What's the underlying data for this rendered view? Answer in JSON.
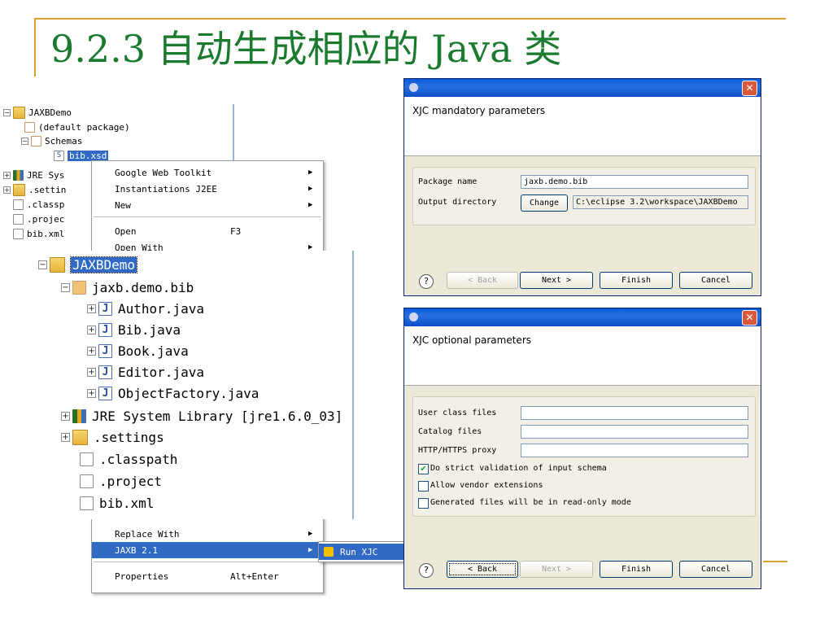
{
  "slide": {
    "title": "9.2.3  自动生成相应的 Java 类"
  },
  "small_tree": {
    "items": [
      {
        "label": "JAXBDemo",
        "toggle": "−"
      },
      {
        "label": "(default package)",
        "toggle": ""
      },
      {
        "label": "Schemas",
        "toggle": "−"
      },
      {
        "label": "bib.xsd",
        "toggle": "",
        "badge": "S"
      },
      {
        "label": "JRE Sys",
        "toggle": "+"
      },
      {
        "label": ".settin",
        "toggle": "+"
      },
      {
        "label": ".classp",
        "toggle": ""
      },
      {
        "label": ".projec",
        "toggle": ""
      },
      {
        "label": "bib.xml",
        "toggle": ""
      }
    ]
  },
  "context_menu": {
    "items": [
      {
        "label": "Google Web Toolkit",
        "accel": "",
        "submenu": true
      },
      {
        "label": "Instantiations J2EE",
        "accel": "",
        "submenu": true
      },
      {
        "label": "New",
        "accel": "",
        "submenu": true
      },
      {
        "label": "Open",
        "accel": "F3",
        "submenu": false
      },
      {
        "label": "Open With",
        "accel": "",
        "submenu": true
      }
    ],
    "bottom_items": [
      {
        "label": "Replace With",
        "accel": "",
        "submenu": true
      },
      {
        "label": "JAXB 2.1",
        "accel": "",
        "submenu": true,
        "selected": true
      },
      {
        "label": "Properties",
        "accel": "Alt+Enter",
        "submenu": false
      }
    ],
    "submenu_item": "Run XJC",
    "arrow": "▶"
  },
  "big_tree": {
    "items": [
      {
        "label": "JAXBDemo",
        "toggle": "−",
        "icon": "project-folder-icon",
        "selected": true
      },
      {
        "label": "jaxb.demo.bib",
        "toggle": "−",
        "icon": "package-icon"
      },
      {
        "label": "Author.java",
        "toggle": "+",
        "icon": "java-file-icon"
      },
      {
        "label": "Bib.java",
        "toggle": "+",
        "icon": "java-file-icon"
      },
      {
        "label": "Book.java",
        "toggle": "+",
        "icon": "java-file-icon"
      },
      {
        "label": "Editor.java",
        "toggle": "+",
        "icon": "java-file-icon"
      },
      {
        "label": "ObjectFactory.java",
        "toggle": "+",
        "icon": "java-file-icon"
      },
      {
        "label": "JRE System Library [jre1.6.0_03]",
        "toggle": "+",
        "icon": "library-icon"
      },
      {
        "label": ".settings",
        "toggle": "+",
        "icon": "folder-icon"
      },
      {
        "label": ".classpath",
        "toggle": "",
        "icon": "file-icon"
      },
      {
        "label": ".project",
        "toggle": "",
        "icon": "file-icon"
      },
      {
        "label": "bib.xml",
        "toggle": "",
        "icon": "file-icon"
      }
    ]
  },
  "dialog1": {
    "close": "✕",
    "heading": "XJC mandatory parameters",
    "package_label": "Package name",
    "package_value": "jaxb.demo.bib",
    "output_label": "Output directory",
    "change_button": "Change",
    "output_value": "C:\\eclipse 3.2\\workspace\\JAXBDemo",
    "help": "?",
    "back": "< Back",
    "next": "Next >",
    "finish": "Finish",
    "cancel": "Cancel"
  },
  "dialog2": {
    "close": "✕",
    "heading": "XJC optional parameters",
    "user_class_label": "User class files",
    "catalog_label": "Catalog files",
    "proxy_label": "HTTP/HTTPS proxy",
    "user_class_value": "",
    "catalog_value": "",
    "proxy_value": "",
    "check1": {
      "label": "Do strict validation of input schema",
      "checked": true,
      "mark": "✔"
    },
    "check2": {
      "label": "Allow vendor extensions",
      "checked": false
    },
    "check3": {
      "label": "Generated files will be in read-only mode",
      "checked": false
    },
    "help": "?",
    "back": "< Back",
    "next": "Next >",
    "finish": "Finish",
    "cancel": "Cancel"
  },
  "colors": {
    "title_green": "#1a7a2e",
    "accent_gold": "#d9a22e",
    "selection_blue": "#316ac5",
    "dialog_title_blue": "#0a5bd8"
  }
}
